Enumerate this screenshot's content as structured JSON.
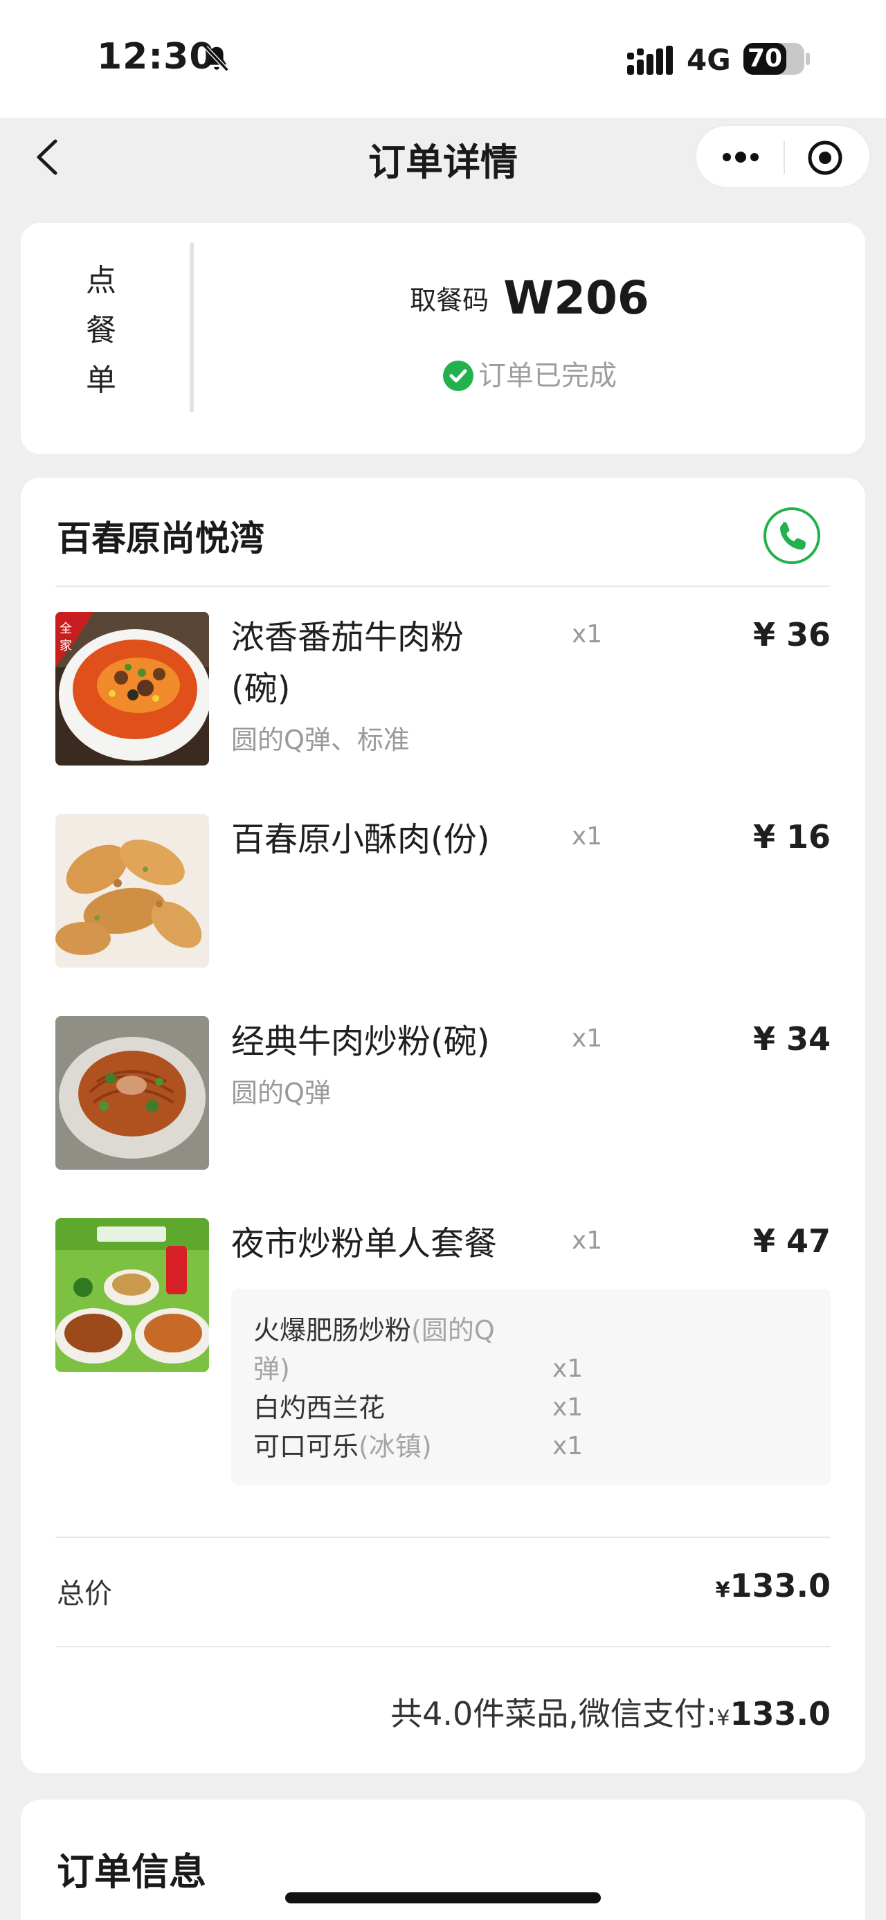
{
  "status_bar": {
    "time": "12:30",
    "network": "4G",
    "battery": "70",
    "battery_level": 0.7
  },
  "nav": {
    "title": "订单详情"
  },
  "pickup": {
    "vertical_label": [
      "点",
      "餐",
      "单"
    ],
    "code_label": "取餐码",
    "code_value": "W206",
    "status": "订单已完成"
  },
  "store": {
    "name": "百春原尚悦湾"
  },
  "items": [
    {
      "name_lines": [
        "浓香番茄牛肉粉",
        "(碗)"
      ],
      "spec": "圆的Q弹、标准",
      "qty": "x1",
      "price": "¥ 36",
      "image": "tomato-beef-noodle-image"
    },
    {
      "name_lines": [
        "百春原小酥肉(份)"
      ],
      "spec": "",
      "qty": "x1",
      "price": "¥ 16",
      "image": "crispy-pork-image"
    },
    {
      "name_lines": [
        "经典牛肉炒粉(碗)"
      ],
      "spec": "圆的Q弹",
      "qty": "x1",
      "price": "¥ 34",
      "image": "fried-noodle-image"
    },
    {
      "name_lines": [
        "夜市炒粉单人套餐"
      ],
      "spec": "",
      "qty": "x1",
      "price": "¥ 47",
      "image": "combo-set-image"
    }
  ],
  "combo": [
    {
      "name": "火爆肥肠炒粉",
      "spec": "(圆的Q弹)",
      "qty": "x1"
    },
    {
      "name": "白灼西兰花",
      "spec": "",
      "qty": "x1"
    },
    {
      "name": "可口可乐",
      "spec": "(冰镇)",
      "qty": "x1"
    }
  ],
  "totals": {
    "total_label": "总价",
    "currency": "¥",
    "total_value": "133.0",
    "summary_prefix": "共4.0件菜品,微信支付:",
    "summary_value": "133.0"
  },
  "order_info": {
    "title": "订单信息"
  },
  "colors": {
    "success_green": "#22b14c",
    "background": "#efefef"
  }
}
